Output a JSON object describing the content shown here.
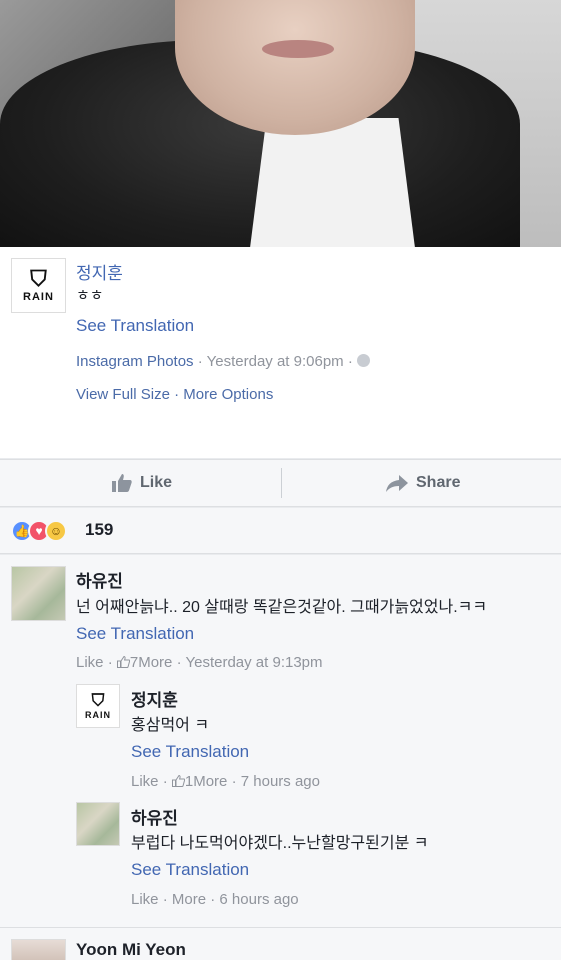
{
  "post": {
    "author": "정지훈",
    "avatar_logo_text": "RAIN",
    "text": "ㅎㅎ",
    "see_translation": "See Translation",
    "source": "Instagram Photos",
    "time": "Yesterday at 9:06pm",
    "view_full_size": "View Full Size",
    "more_options": "More Options"
  },
  "actions": {
    "like": "Like",
    "share": "Share"
  },
  "reactions": {
    "count": "159",
    "icons": [
      "like-icon",
      "love-icon",
      "haha-icon"
    ]
  },
  "comments": [
    {
      "author": "하유진",
      "text": "넌 어째안늙냐.. 20 살때랑 똑같은것같아. 그때가늙었었나.ㅋㅋ",
      "see_translation": "See Translation",
      "like": "Like",
      "reactions": "7",
      "more": "More",
      "time": "Yesterday at 9:13pm",
      "replies": [
        {
          "author": "정지훈",
          "avatar_logo_text": "RAIN",
          "text": "홍삼먹어 ㅋ",
          "see_translation": "See Translation",
          "like": "Like",
          "reactions": "1",
          "more": "More",
          "time": "7 hours ago"
        },
        {
          "author": "하유진",
          "text": "부럽다 나도먹어야겠다..누난할망구된기분 ㅋ",
          "see_translation": "See Translation",
          "like": "Like",
          "more": "More",
          "time": "6 hours ago"
        }
      ]
    },
    {
      "author": "Yoon Mi Yeon"
    }
  ],
  "colors": {
    "link_blue": "#4267b2",
    "meta_gray": "#90949c",
    "like_blue": "#5890ff",
    "love_red": "#f25268",
    "haha_yellow": "#f7c844"
  }
}
